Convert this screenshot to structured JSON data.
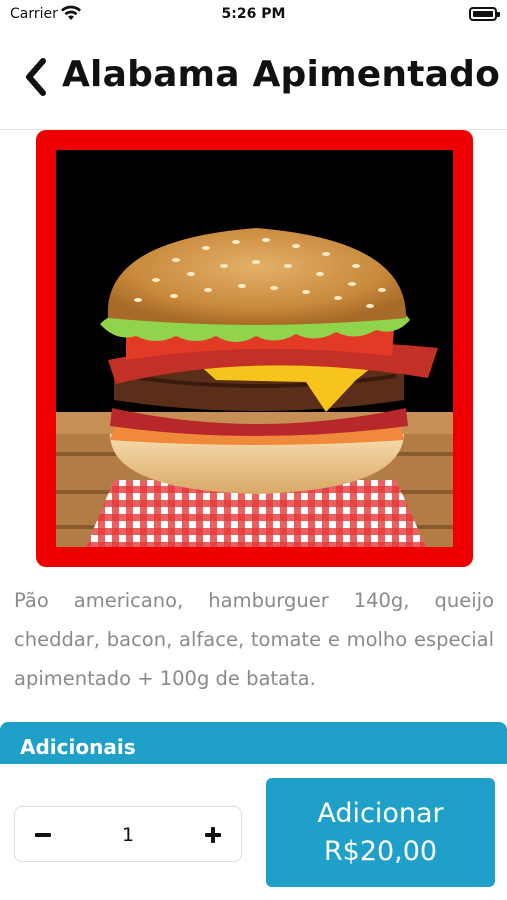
{
  "status_bar": {
    "carrier": "Carrier",
    "time": "5:26 PM",
    "wifi_icon": "wifi-icon",
    "battery_icon": "battery-icon"
  },
  "header": {
    "back_icon": "chevron-left-icon",
    "title": "Alabama Apimentado"
  },
  "product": {
    "image": "burger-photo",
    "frame_color": "#ee0000",
    "description": "Pão americano, hamburguer 140g, queijo cheddar, bacon, alface, tomate e molho especial apimentado + 100g de batata."
  },
  "sections": {
    "adicionais_label": "Adicionais",
    "accent_color": "#1fa0c9"
  },
  "order": {
    "quantity": "1",
    "minus_icon": "minus-icon",
    "plus_icon": "plus-icon",
    "add_label": "Adicionar",
    "add_price": "R$20,00"
  }
}
